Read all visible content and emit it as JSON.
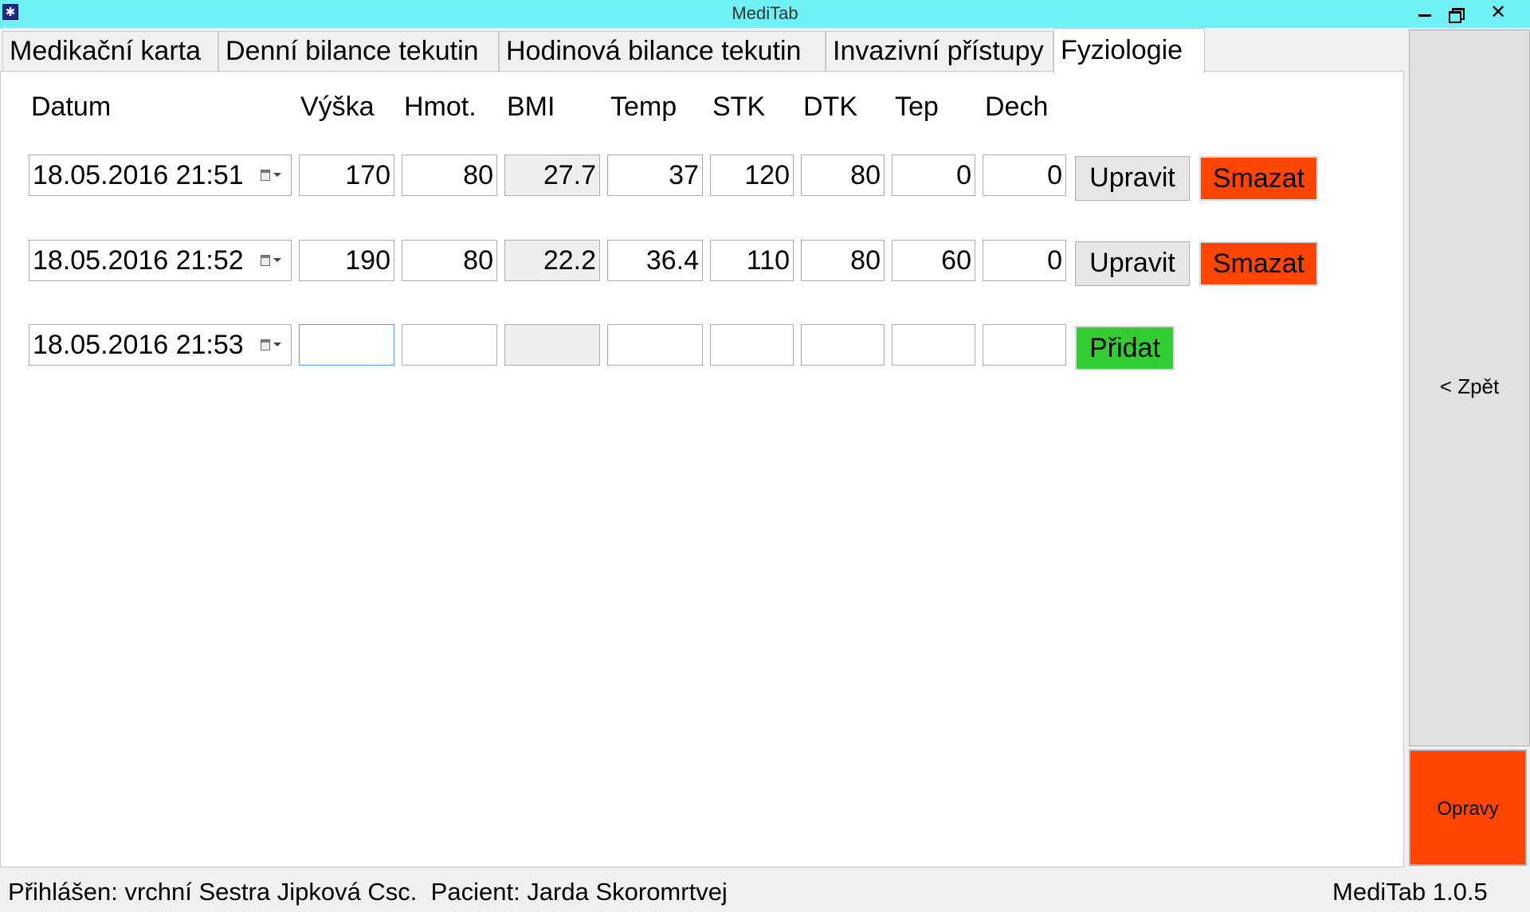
{
  "window": {
    "title": "MediTab",
    "app_icon_glyph": "✱",
    "minimize_icon": "minimize-icon",
    "maximize_icon": "restore-icon",
    "close_glyph": "✕"
  },
  "tabs": [
    {
      "label": "Medikační karta"
    },
    {
      "label": "Denní bilance tekutin"
    },
    {
      "label": "Hodinová bilance tekutin"
    },
    {
      "label": "Invazivní přístupy"
    },
    {
      "label": "Fyziologie",
      "active": true
    }
  ],
  "table": {
    "headers": [
      "Datum",
      "Výška",
      "Hmot.",
      "BMI",
      "Temp",
      "STK",
      "DTK",
      "Tep",
      "Dech"
    ],
    "rows": [
      {
        "date": "18.05.2016 21:51",
        "vyska": "170",
        "hmot": "80",
        "bmi": "27.7",
        "temp": "37",
        "stk": "120",
        "dtk": "80",
        "tep": "0",
        "dech": "0"
      },
      {
        "date": "18.05.2016 21:52",
        "vyska": "190",
        "hmot": "80",
        "bmi": "22.2",
        "temp": "36.4",
        "stk": "110",
        "dtk": "80",
        "tep": "60",
        "dech": "0"
      }
    ],
    "new_row": {
      "date": "18.05.2016 21:53",
      "vyska": "",
      "hmot": "",
      "bmi": "",
      "temp": "",
      "stk": "",
      "dtk": "",
      "tep": "",
      "dech": ""
    },
    "edit_label": "Upravit",
    "delete_label": "Smazat",
    "add_label": "Přidat"
  },
  "side": {
    "back_label": "< Zpět",
    "corrections_label": "Opravy"
  },
  "status": {
    "user": "Přihlášen: vrchní Sestra Jipková Csc.",
    "patient": "Pacient: Jarda Skoromrtvej",
    "version": "MediTab 1.0.5"
  },
  "colors": {
    "titlebar": "#6ff0f5",
    "delete": "#ff4500",
    "add": "#32cd32",
    "corrections": "#ff4500"
  }
}
